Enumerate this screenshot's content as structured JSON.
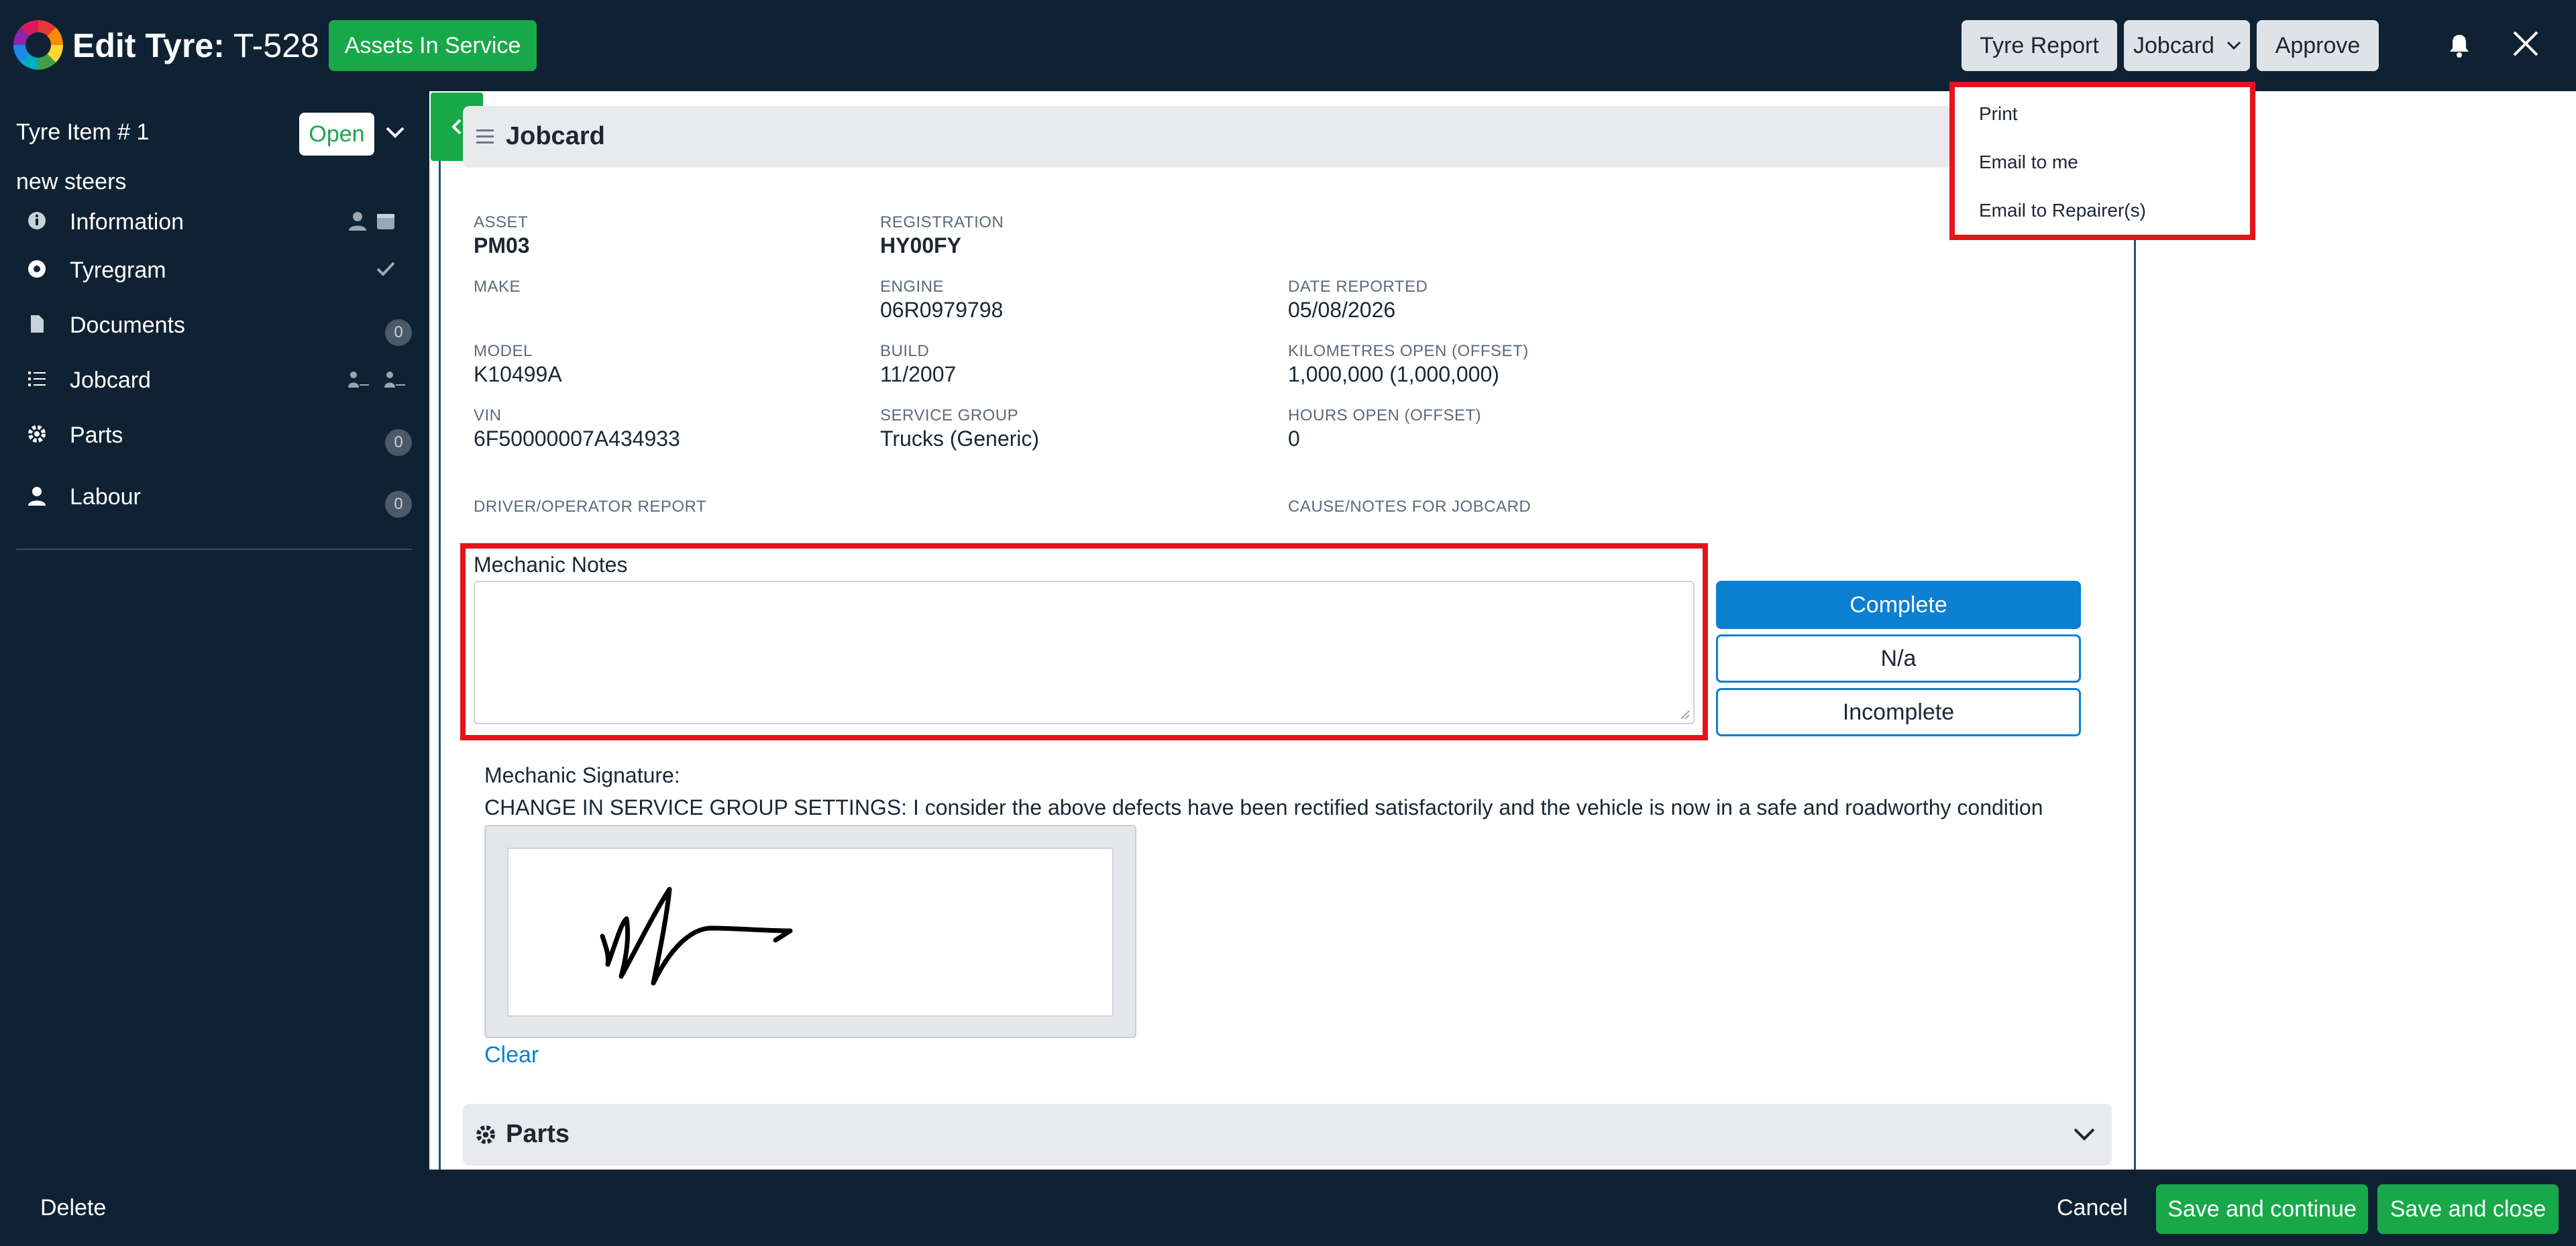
{
  "header": {
    "title_bold": "Edit Tyre:",
    "title_id": "T-528",
    "status_button": "Assets In Service",
    "tyre_report_button": "Tyre Report",
    "jobcard_button": "Jobcard",
    "approve_button": "Approve"
  },
  "jobcard_menu": {
    "items": [
      "Print",
      "Email to me",
      "Email to Repairer(s)"
    ]
  },
  "sidebar": {
    "item_title": "Tyre Item # 1",
    "status_badge": "Open",
    "subtitle": "new steers",
    "nav": [
      {
        "label": "Information",
        "icon": "info-icon"
      },
      {
        "label": "Tyregram",
        "icon": "tyregram-icon"
      },
      {
        "label": "Documents",
        "icon": "document-icon",
        "count": "0"
      },
      {
        "label": "Jobcard",
        "icon": "list-icon"
      },
      {
        "label": "Parts",
        "icon": "gear-icon",
        "count": "0"
      },
      {
        "label": "Labour",
        "icon": "user-icon",
        "count": "0"
      }
    ]
  },
  "jobcard": {
    "section_title": "Jobcard",
    "fields": {
      "asset": {
        "label": "ASSET",
        "value": "PM03"
      },
      "registration": {
        "label": "REGISTRATION",
        "value": "HY00FY"
      },
      "make": {
        "label": "MAKE",
        "value": ""
      },
      "engine": {
        "label": "ENGINE",
        "value": "06R0979798"
      },
      "date_reported": {
        "label": "DATE REPORTED",
        "value": "05/08/2026"
      },
      "model": {
        "label": "MODEL",
        "value": "K10499A"
      },
      "build": {
        "label": "BUILD",
        "value": "11/2007"
      },
      "kilometres_open": {
        "label": "KILOMETRES OPEN (OFFSET)",
        "value": "1,000,000 (1,000,000)"
      },
      "vin": {
        "label": "VIN",
        "value": "6F50000007A434933"
      },
      "service_group": {
        "label": "SERVICE GROUP",
        "value": "Trucks (Generic)"
      },
      "hours_open": {
        "label": "HOURS OPEN (OFFSET)",
        "value": "0"
      },
      "driver_report": {
        "label": "DRIVER/OPERATOR REPORT",
        "value": ""
      },
      "cause_notes": {
        "label": "CAUSE/NOTES FOR JOBCARD",
        "value": ""
      }
    },
    "mechanic_notes_label": "Mechanic Notes",
    "mechanic_notes_value": "",
    "status_buttons": {
      "complete": "Complete",
      "na": "N/a",
      "incomplete": "Incomplete"
    },
    "signature_label": "Mechanic Signature:",
    "signature_statement": "CHANGE IN SERVICE GROUP SETTINGS: I consider the above defects have been rectified satisfactorily and the vehicle is now in a safe and roadworthy condition",
    "clear_link": "Clear"
  },
  "parts_section": {
    "title": "Parts"
  },
  "footer": {
    "delete": "Delete",
    "cancel": "Cancel",
    "save_continue": "Save and continue",
    "save_close": "Save and close"
  },
  "colors": {
    "background": "#0f2233",
    "accent_green": "#18a84a",
    "accent_blue": "#0b7fd1",
    "highlight_red": "#e5141b"
  }
}
